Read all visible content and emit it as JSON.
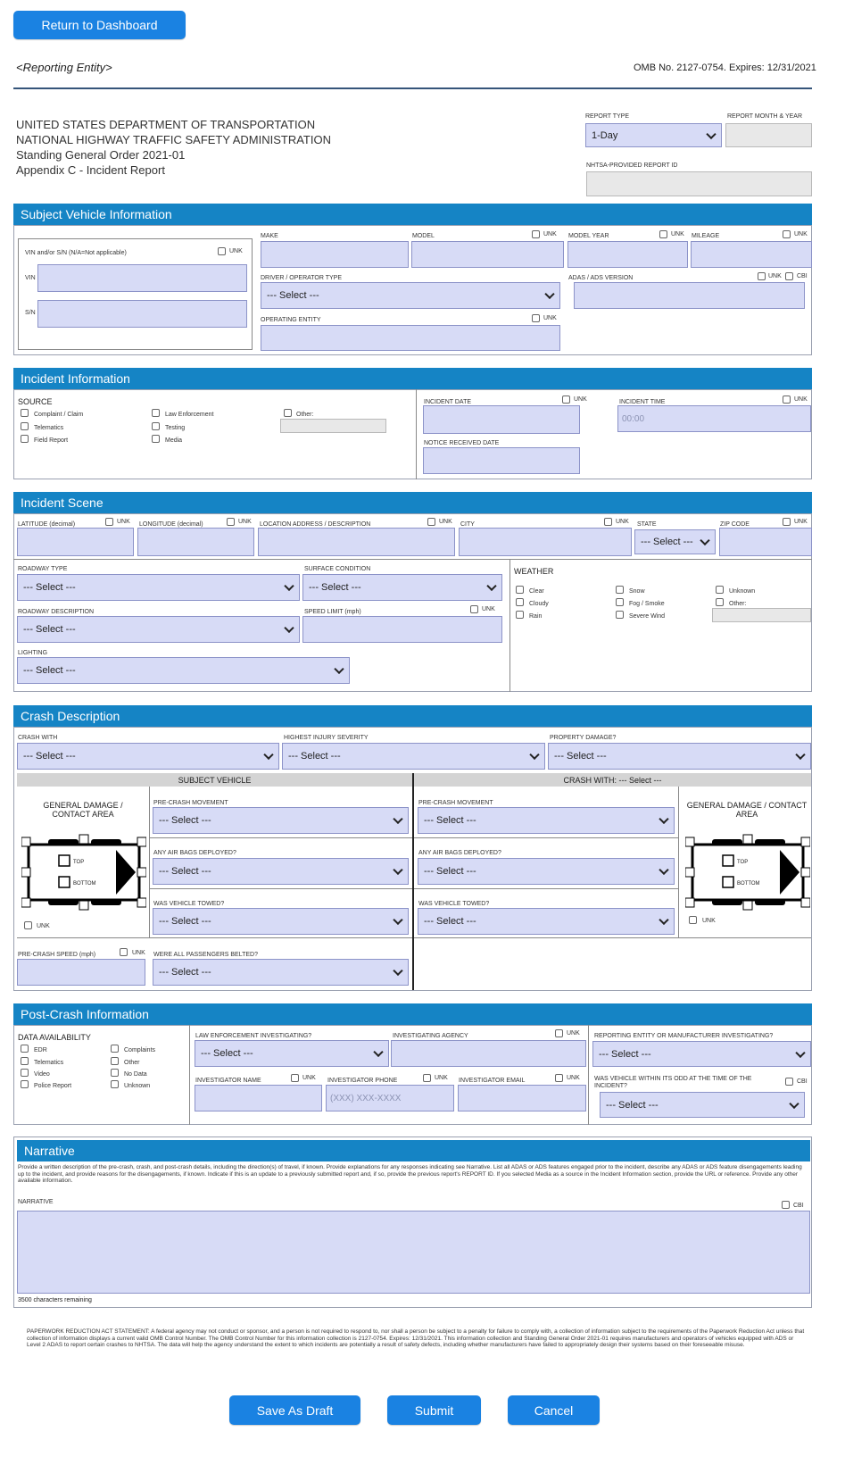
{
  "header": {
    "return_button": "Return to Dashboard",
    "reporting_entity": "<Reporting Entity>",
    "omb": "OMB No. 2127-0754. Expires: 12/31/2021",
    "agency_lines": [
      "UNITED STATES DEPARTMENT OF TRANSPORTATION",
      "NATIONAL HIGHWAY TRAFFIC SAFETY ADMINISTRATION",
      "Standing General Order 2021-01",
      "Appendix C - Incident Report"
    ],
    "report_type_label": "REPORT TYPE",
    "report_type_value": "1-Day",
    "report_month_label": "REPORT MONTH & YEAR",
    "report_id_label": "NHTSA-PROVIDED REPORT ID"
  },
  "common": {
    "select": "--- Select ---",
    "unk": "UNK",
    "cbi": "CBI"
  },
  "vehicle": {
    "title": "Subject Vehicle Information",
    "vin_sn_label": "VIN and/or S/N (N/A=Not applicable)",
    "vin_label": "VIN",
    "sn_label": "S/N",
    "make_label": "MAKE",
    "model_label": "MODEL",
    "model_year_label": "MODEL YEAR",
    "mileage_label": "MILEAGE",
    "driver_type_label": "DRIVER / OPERATOR TYPE",
    "adas_label": "ADAS / ADS VERSION",
    "operating_entity_label": "OPERATING ENTITY"
  },
  "incident": {
    "title": "Incident Information",
    "source_label": "SOURCE",
    "sources": [
      "Complaint / Claim",
      "Telematics",
      "Field Report",
      "Law Enforcement",
      "Testing",
      "Media",
      "Other:"
    ],
    "date_label": "INCIDENT DATE",
    "time_label": "INCIDENT TIME",
    "time_placeholder": "00:00",
    "notice_label": "NOTICE RECEIVED DATE"
  },
  "scene": {
    "title": "Incident Scene",
    "latitude_label": "LATITUDE (decimal)",
    "longitude_label": "LONGITUDE (decimal)",
    "address_label": "LOCATION ADDRESS / DESCRIPTION",
    "city_label": "CITY",
    "state_label": "STATE",
    "zip_label": "ZIP CODE",
    "roadway_type_label": "ROADWAY TYPE",
    "surface_label": "SURFACE CONDITION",
    "roadway_desc_label": "ROADWAY DESCRIPTION",
    "speed_limit_label": "SPEED LIMIT (mph)",
    "lighting_label": "LIGHTING",
    "weather_label": "WEATHER",
    "weather": [
      "Clear",
      "Cloudy",
      "Rain",
      "Snow",
      "Fog / Smoke",
      "Severe Wind",
      "Unknown",
      "Other:"
    ]
  },
  "crash": {
    "title": "Crash Description",
    "crash_with_label": "CRASH WITH",
    "injury_label": "HIGHEST INJURY SEVERITY",
    "property_label": "PROPERTY DAMAGE?",
    "subject_header": "SUBJECT VEHICLE",
    "crash_with_header": "CRASH WITH: --- Select ---",
    "damage_label": "GENERAL DAMAGE / CONTACT AREA",
    "top": "TOP",
    "bottom": "BOTTOM",
    "pre_movement_label": "PRE-CRASH MOVEMENT",
    "airbags_label": "ANY AIR BAGS DEPLOYED?",
    "towed_label": "WAS VEHICLE TOWED?",
    "pre_speed_label": "PRE-CRASH SPEED (mph)",
    "belted_label": "WERE ALL PASSENGERS BELTED?"
  },
  "post": {
    "title": "Post-Crash Information",
    "data_label": "DATA AVAILABILITY",
    "data_items": [
      "EDR",
      "Telematics",
      "Video",
      "Police Report",
      "Complaints",
      "Other",
      "No Data",
      "Unknown"
    ],
    "law_label": "LAW ENFORCEMENT INVESTIGATING?",
    "agency_label": "INVESTIGATING AGENCY",
    "manufacturer_label": "REPORTING ENTITY OR MANUFACTURER INVESTIGATING?",
    "inv_name_label": "INVESTIGATOR NAME",
    "inv_phone_label": "INVESTIGATOR PHONE",
    "inv_phone_placeholder": "(XXX) XXX-XXXX",
    "inv_email_label": "INVESTIGATOR EMAIL",
    "odd_label": "WAS VEHICLE WITHIN ITS ODD AT THE TIME OF THE INCIDENT?"
  },
  "narrative": {
    "title": "Narrative",
    "instructions": "Provide a written description of the pre-crash, crash, and post-crash details, including the direction(s) of travel, if known. Provide explanations for any responses indicating see Narrative. List all ADAS or ADS features engaged prior to the incident, describe any ADAS or ADS feature disengagements leading up to the incident, and provide reasons for the disengagements, if known. Indicate if this is an update to a previously submitted report and, if so, provide the previous report's REPORT ID. If you selected Media as a source in the Incident Information section, provide the URL or reference. Provide any other available information.",
    "label": "NARRATIVE",
    "remaining": "3500 characters remaining"
  },
  "footer": {
    "paperwork": "PAPERWORK REDUCTION ACT STATEMENT: A federal agency may not conduct or sponsor, and a person is not required to respond to, nor shall a person be subject to a penalty for failure to comply with, a collection of information subject to the requirements of the Paperwork Reduction Act unless that collection of information displays a current valid OMB Control Number. The OMB Control Number for this information collection is 2127-0754. Expires: 12/31/2021. This information collection and Standing General Order 2021-01 requires manufacturers and operators of vehicles equipped with ADS or Level 2 ADAS to report certain crashes to NHTSA. The data will help the agency understand the extent to which incidents are potentially a result of safety defects, including whether manufacturers have failed to appropriately design their systems based on their foreseeable misuse.",
    "save_draft": "Save As Draft",
    "submit": "Submit",
    "cancel": "Cancel"
  },
  "colors": {
    "accent": "#1a82e2",
    "section_bar": "#1584c5",
    "field": "#d7dbf6"
  }
}
